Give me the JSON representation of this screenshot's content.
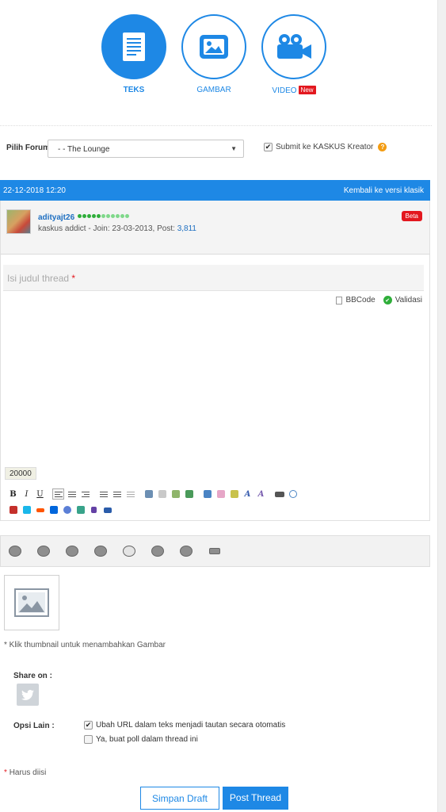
{
  "post_types": [
    {
      "label": "TEKS",
      "icon": "document-icon",
      "active": true
    },
    {
      "label": "GAMBAR",
      "icon": "image-icon",
      "active": false
    },
    {
      "label": "VIDEO",
      "icon": "video-camera-icon",
      "active": false,
      "badge": "New"
    }
  ],
  "forum": {
    "label": "Pilih Forum",
    "selected": "- - The Lounge",
    "kreator_label": "Submit ke KASKUS Kreator",
    "kreator_checked": true
  },
  "header_bar": {
    "date": "22-12-2018 12:20",
    "classic_link": "Kembali ke versi klasik",
    "color": "#1e88e5"
  },
  "user": {
    "name": "adityajt26",
    "rank": "kaskus addict",
    "join_label": "Join:",
    "join_date": "23-03-2013",
    "post_label": "Post:",
    "posts": "3,811",
    "reputation_dots_filled": 5,
    "reputation_dots_total": 11,
    "badge": "Beta"
  },
  "editor": {
    "title_placeholder": "Isi judul thread",
    "required_mark": "*",
    "bbcode_label": "BBCode",
    "validasi_label": "Validasi",
    "char_limit": "20000"
  },
  "toolbar_row1": [
    "B",
    "I",
    "U"
  ],
  "emoticons": [
    "emoticon-1",
    "emoticon-2",
    "emoticon-3",
    "emoticon-4",
    "emoticon-5",
    "emoticon-6",
    "emoticon-7",
    "emoticon-8"
  ],
  "image_upload": {
    "hint": "* Klik thumbnail untuk menambahkan Gambar"
  },
  "share": {
    "label": "Share on :"
  },
  "options": {
    "label": "Opsi Lain :",
    "items": [
      {
        "label": "Ubah URL dalam teks menjadi tautan secara otomatis",
        "checked": true
      },
      {
        "label": "Ya, buat poll dalam thread ini",
        "checked": false
      }
    ]
  },
  "footer": {
    "required_note": "Harus diisi",
    "draft_button": "Simpan Draft",
    "post_button": "Post Thread"
  }
}
